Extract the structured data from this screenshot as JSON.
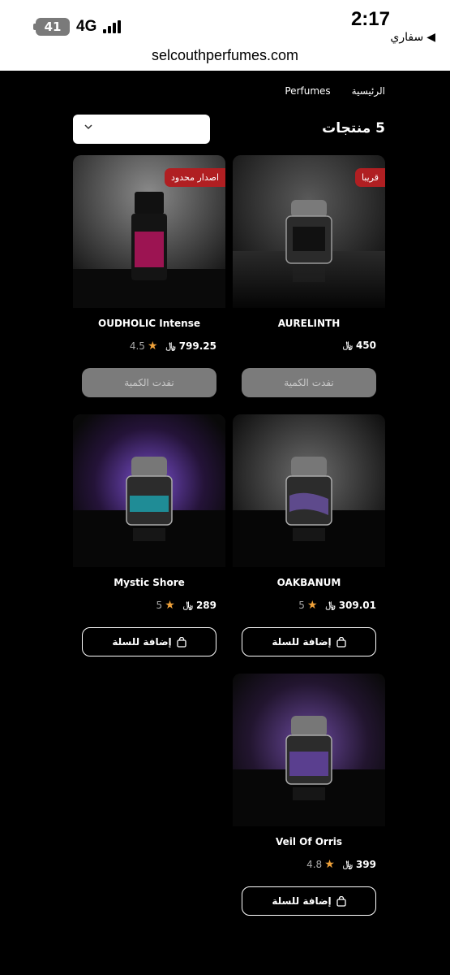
{
  "status_bar": {
    "battery": "41",
    "network": "4G",
    "time": "2:17",
    "back_app": "سفاري"
  },
  "browser": {
    "url": "selcouthperfumes.com"
  },
  "breadcrumb": {
    "home": "الرئيسية",
    "current": "Perfumes"
  },
  "listing": {
    "count": "5 منتجات",
    "sort_value": ""
  },
  "currency_symbol": "﷼",
  "products": [
    {
      "name": "AURELINTH",
      "price": "450",
      "rating": "",
      "badge": "قريبا",
      "button": "نفدت الكمية",
      "stock": "out"
    },
    {
      "name": "OUDHOLIC Intense",
      "price": "799.25",
      "rating": "4.5",
      "badge": "اصدار محدود",
      "button": "نفدت الكمية",
      "stock": "out"
    },
    {
      "name": "OAKBANUM",
      "price": "309.01",
      "rating": "5",
      "badge": "",
      "button": "إضافة للسلة",
      "stock": "in"
    },
    {
      "name": "Mystic Shore",
      "price": "289",
      "rating": "5",
      "badge": "",
      "button": "إضافة للسلة",
      "stock": "in"
    },
    {
      "name": "Veil Of Orris",
      "price": "399",
      "rating": "4.8",
      "badge": "",
      "button": "إضافة للسلة",
      "stock": "in"
    }
  ],
  "colors": {
    "accent_badge": "#b01f22",
    "star": "#f0a23a",
    "disabled_button": "#7b7b7b"
  },
  "icons": {
    "sort": "chevron-down-icon",
    "cart": "shopping-bag-icon",
    "rating": "star-icon",
    "back": "back-arrow-icon"
  }
}
